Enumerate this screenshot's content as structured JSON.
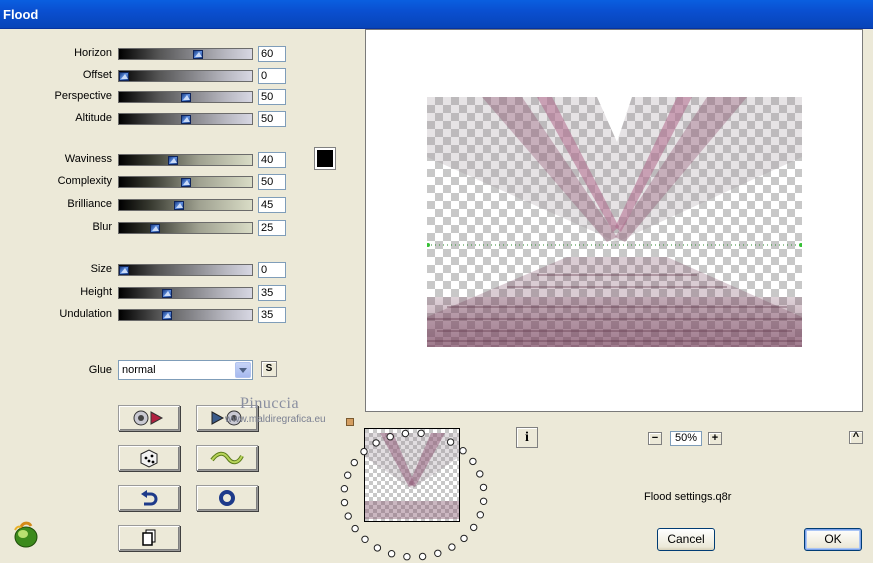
{
  "window": {
    "title": "Flood"
  },
  "sliders": [
    {
      "key": "horizon",
      "label": "Horizon",
      "value": "60",
      "fraction": 0.6,
      "style": "dark"
    },
    {
      "key": "offset",
      "label": "Offset",
      "value": "0",
      "fraction": 0.0,
      "style": "dark"
    },
    {
      "key": "perspective",
      "label": "Perspective",
      "value": "50",
      "fraction": 0.5,
      "style": "dark"
    },
    {
      "key": "altitude",
      "label": "Altitude",
      "value": "50",
      "fraction": 0.5,
      "style": "dark"
    },
    {
      "key": "waviness",
      "label": "Waviness",
      "value": "40",
      "fraction": 0.4,
      "style": "olive"
    },
    {
      "key": "complexity",
      "label": "Complexity",
      "value": "50",
      "fraction": 0.5,
      "style": "olive"
    },
    {
      "key": "brilliance",
      "label": "Brilliance",
      "value": "45",
      "fraction": 0.45,
      "style": "olive"
    },
    {
      "key": "blur",
      "label": "Blur",
      "value": "25",
      "fraction": 0.25,
      "style": "olive"
    },
    {
      "key": "size",
      "label": "Size",
      "value": "0",
      "fraction": 0.0,
      "style": "dark"
    },
    {
      "key": "height",
      "label": "Height",
      "value": "35",
      "fraction": 0.35,
      "style": "dark"
    },
    {
      "key": "undulation",
      "label": "Undulation",
      "value": "35",
      "fraction": 0.35,
      "style": "dark"
    }
  ],
  "color_swatch": {
    "color": "#000000"
  },
  "glue": {
    "label": "Glue",
    "value": "normal",
    "s_button": "S"
  },
  "watermark": {
    "name": "Pinuccia",
    "site": "www.maldiregrafica.eu"
  },
  "zoom": {
    "value": "50%",
    "minus": "−",
    "plus": "+",
    "up": "^"
  },
  "info_button": "i",
  "settings_file": "Flood settings.q8r",
  "buttons": {
    "cancel": "Cancel",
    "ok": "OK"
  },
  "icons": {
    "play_effect": "play-effect-icon",
    "forward_effect": "forward-effect-icon",
    "random": "dice-icon",
    "wave": "wave-icon",
    "undo": "undo-icon",
    "reset": "reset-ring-icon",
    "copy": "copy-icon",
    "logo": "plugin-logo-icon"
  }
}
